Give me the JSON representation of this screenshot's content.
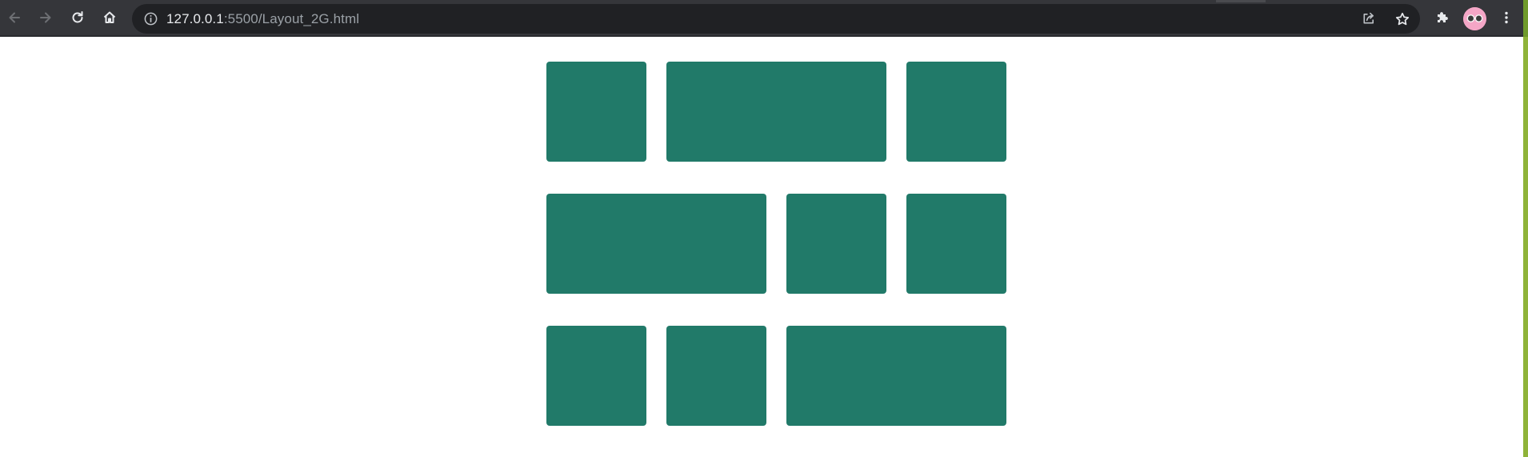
{
  "browser": {
    "url_host": "127.0.0.1",
    "url_rest": ":5500/Layout_2G.html",
    "icons": {
      "back": "back-arrow-icon",
      "forward": "forward-arrow-icon",
      "reload": "reload-icon",
      "home": "home-icon",
      "info": "info-icon",
      "share": "share-icon",
      "bookmark": "star-icon",
      "extensions": "puzzle-icon",
      "menu": "kebab-menu-icon"
    },
    "colors": {
      "toolbar": "#35363a",
      "omnibox": "#202124",
      "accent_strip": "#8fb339"
    }
  },
  "layout": {
    "box_color": "#217a69",
    "rows": [
      {
        "boxes": [
          {
            "span": 1
          },
          {
            "span": 2
          },
          {
            "span": 1
          }
        ]
      },
      {
        "boxes": [
          {
            "span": 2
          },
          {
            "span": 1
          },
          {
            "span": 1
          }
        ]
      },
      {
        "boxes": [
          {
            "span": 1
          },
          {
            "span": 1
          },
          {
            "span": 2
          }
        ]
      }
    ]
  }
}
